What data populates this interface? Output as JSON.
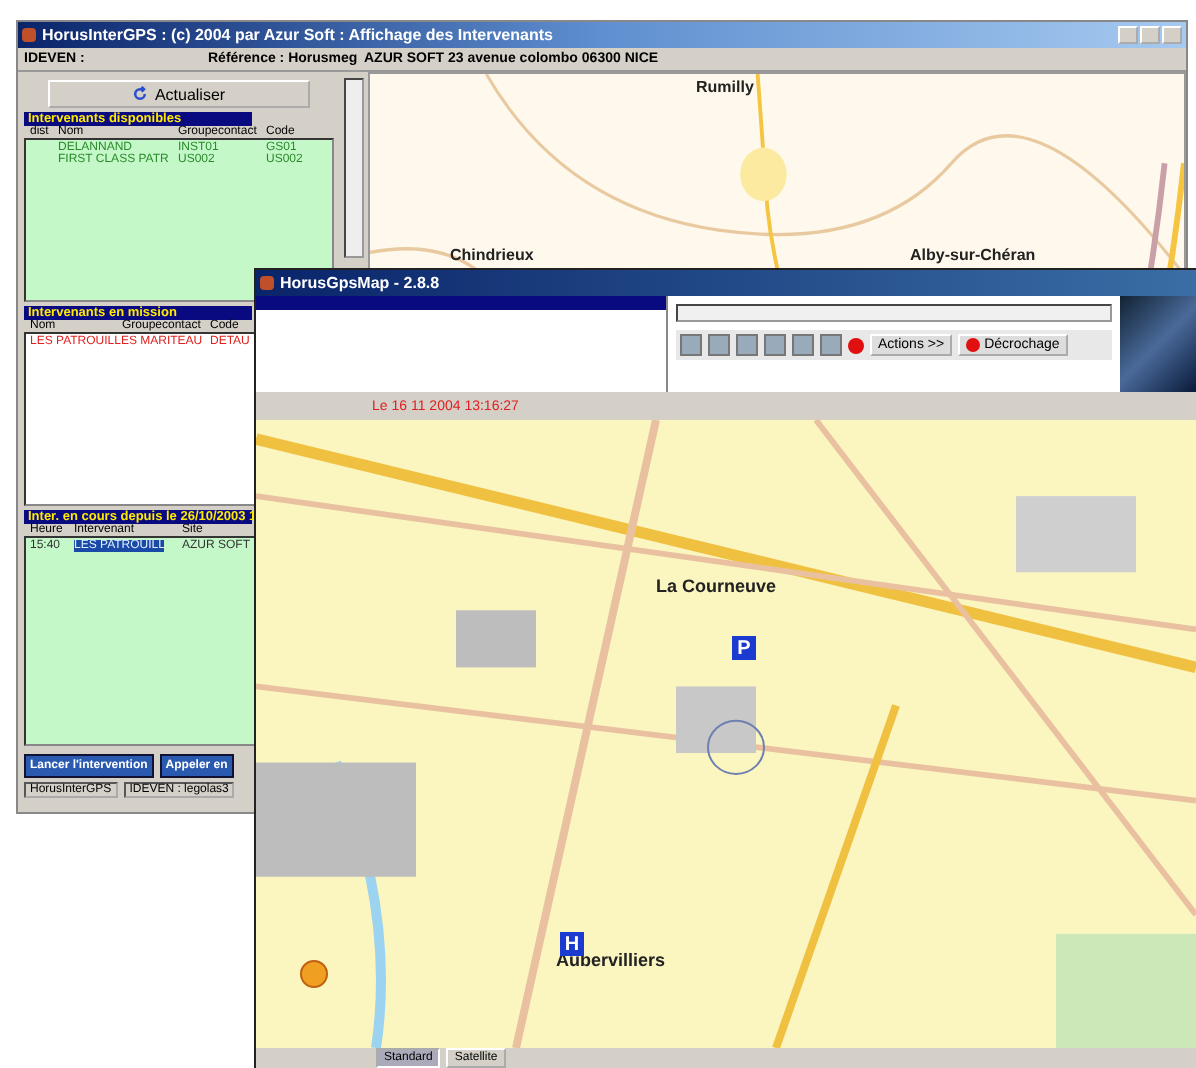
{
  "main_window": {
    "title": "HorusInterGPS : (c) 2004 par Azur Soft : Affichage des Intervenants",
    "info_bar": [
      "IDEVEN :",
      "Référence : Horusmeg",
      "AZUR SOFT 23 avenue colombo 06300 NICE"
    ],
    "refresh_button": "Actualiser",
    "available": {
      "title": "Intervenants disponibles",
      "columns": [
        "dist",
        "Nom",
        "Groupecontact",
        "Code"
      ],
      "rows": [
        {
          "cells": [
            "",
            "DELANNAND",
            "INST01",
            "GS01"
          ]
        },
        {
          "cells": [
            "",
            "FIRST CLASS PATR",
            "US002",
            "US002"
          ]
        }
      ]
    },
    "mission": {
      "title": "Intervenants en mission",
      "columns": [
        "Nom",
        "Groupecontact",
        "Code"
      ],
      "rows": [
        {
          "cells": [
            "LES PATROUILLES MARITEAU",
            "",
            "DETAU"
          ]
        }
      ]
    },
    "current": {
      "title": "Inter. en cours depuis le 26/10/2003 1",
      "columns": [
        "Heure",
        "Intervenant",
        "Site"
      ],
      "rows": [
        {
          "cells": [
            "15:40",
            "LES PATROUILL",
            "AZUR SOFT"
          ],
          "selected": true
        }
      ]
    },
    "buttons": [
      "Lancer l'intervention",
      "Appeler en"
    ],
    "status_bar": [
      "HorusInterGPS",
      "IDEVEN : legolas3"
    ],
    "map_labels": [
      "Rumilly",
      "Chindrieux",
      "Alby-sur-Chéran"
    ]
  },
  "map_window": {
    "title": "HorusGpsMap - 2.8.8",
    "toolbar_buttons": [
      "Actions >>",
      "Décrochage"
    ],
    "date": "Le 16 11 2004 13:16:27",
    "map_labels": [
      "La Courneuve",
      "Aubervilliers"
    ],
    "map_signs": [
      "P",
      "H"
    ],
    "status_tabs": [
      {
        "label": "Standard",
        "selected": true
      },
      {
        "label": "Satellite",
        "selected": false
      }
    ]
  }
}
